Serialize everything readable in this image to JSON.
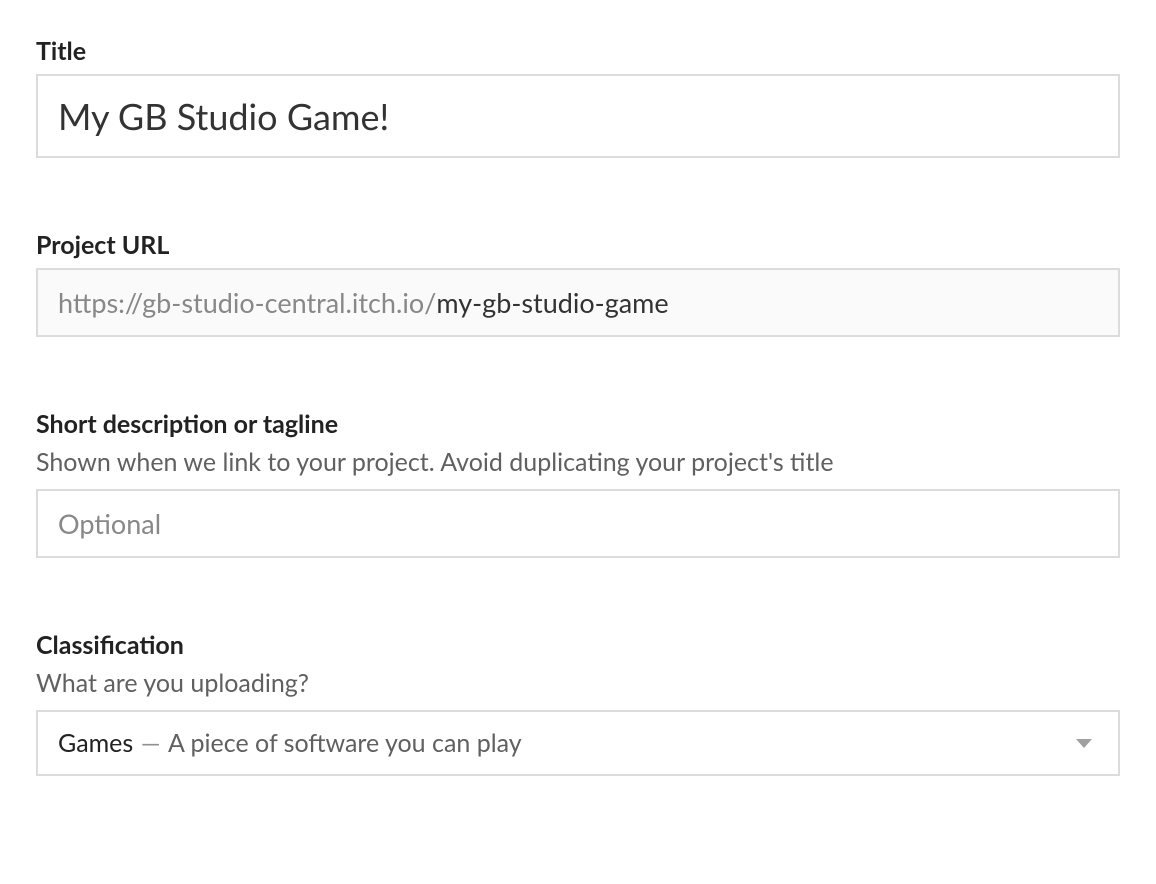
{
  "fields": {
    "title": {
      "label": "Title",
      "value": "My GB Studio Game!"
    },
    "project_url": {
      "label": "Project URL",
      "prefix": "https://gb-studio-central.itch.io/",
      "slug": "my-gb-studio-game"
    },
    "short_description": {
      "label": "Short description or tagline",
      "sublabel": "Shown when we link to your project. Avoid duplicating your project's title",
      "placeholder": "Optional",
      "value": ""
    },
    "classification": {
      "label": "Classification",
      "sublabel": "What are you uploading?",
      "selected_primary": "Games",
      "selected_separator": "—",
      "selected_desc": "A piece of software you can play"
    }
  }
}
